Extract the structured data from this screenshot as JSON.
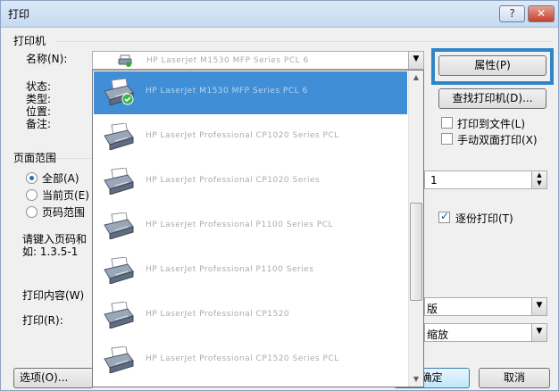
{
  "title": "打印",
  "help_label": "?",
  "close_label": "✕",
  "printer_group": "打印机",
  "name_label": "名称(N):",
  "properties_label": "属性(P)",
  "status_label": "状态:",
  "type_label": "类型:",
  "where_label": "位置:",
  "comment_label": "备注:",
  "find_printer_label": "查找打印机(D)...",
  "print_to_file_label": "打印到文件(L)",
  "manual_duplex_label": "手动双面打印(X)",
  "page_range_group": "页面范围",
  "all_label": "全部(A)",
  "current_page_label": "当前页(E)",
  "pages_label": "页码范围",
  "pages_hint_1": "请键入页码和",
  "pages_hint_2": "如: 1.3.5-1",
  "copies_value": "1",
  "collate_label": "逐份打印(T)",
  "print_what_label": "打印内容(W)",
  "print_label": "打印(R):",
  "print_what_value": "版",
  "zoom_value": "缩放",
  "options_label": "选项(O)...",
  "ok_label": "确定",
  "cancel_label": "取消",
  "selected_printer": "HP LaserJet M1530 MFP Series PCL 6",
  "printers": [
    {
      "name": "HP LaserJet M1530 MFP Series PCL 6",
      "selected": true
    },
    {
      "name": "HP LaserJet Professional CP1020 Series PCL",
      "selected": false
    },
    {
      "name": "HP LaserJet Professional CP1020 Series",
      "selected": false
    },
    {
      "name": "HP LaserJet Professional P1100 Series PCL",
      "selected": false
    },
    {
      "name": "HP LaserJet Professional P1100 Series",
      "selected": false
    },
    {
      "name": "HP LaserJet Professional CP1520",
      "selected": false
    },
    {
      "name": "HP LaserJet Professional CP1520 Series PCL",
      "selected": false
    }
  ]
}
